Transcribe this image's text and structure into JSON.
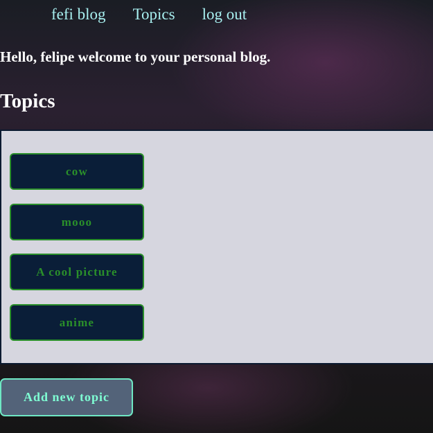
{
  "nav": {
    "home": "fefi blog",
    "topics": "Topics",
    "logout": "log out"
  },
  "greeting": "Hello, felipe welcome to your personal blog.",
  "heading": "Topics",
  "topics": [
    {
      "label": "cow"
    },
    {
      "label": "mooo"
    },
    {
      "label": "A cool picture"
    },
    {
      "label": "anime"
    }
  ],
  "add_button": "Add new topic",
  "colors": {
    "link": "#a8f0f0",
    "topic_text": "#2a8f2a",
    "topic_bg": "#0a1e38",
    "add_text": "#7fffd4",
    "panel_bg": "#d6d6df"
  }
}
